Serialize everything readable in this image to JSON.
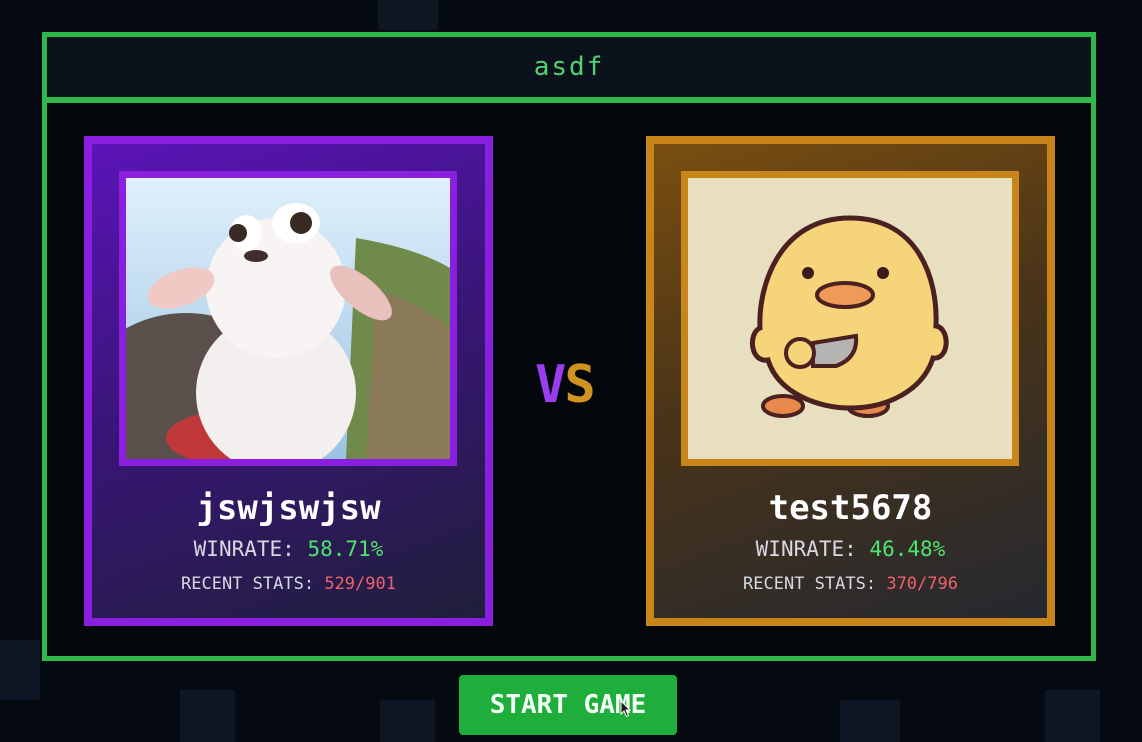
{
  "room": {
    "title": "asdf"
  },
  "players": [
    {
      "name": "jswjswjsw",
      "winrate_label": "WINRATE:",
      "winrate_value": "58.71%",
      "recent_label": "RECENT STATS:",
      "recent_value": "529/901",
      "color": "#8a1fe0",
      "avatar": "white-lamb-avatar"
    },
    {
      "name": "test5678",
      "winrate_label": "WINRATE:",
      "winrate_value": "46.48%",
      "recent_label": "RECENT STATS:",
      "recent_value": "370/796",
      "color": "#c8861a",
      "avatar": "yellow-duck-avatar"
    }
  ],
  "vs": {
    "v": "V",
    "s": "S"
  },
  "actions": {
    "start_label": "START GAME"
  },
  "colors": {
    "frame": "#2fb84c",
    "stat_value_good": "#4ee56e",
    "stat_value_recent": "#f0626a"
  }
}
